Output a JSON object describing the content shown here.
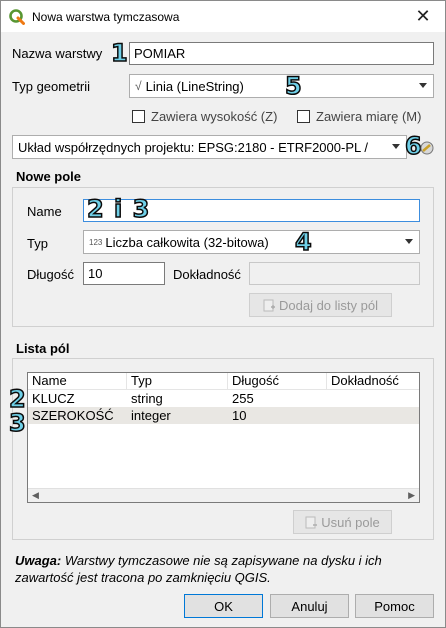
{
  "window": {
    "title": "Nowa warstwa tymczasowa",
    "close_glyph": "✕"
  },
  "layer_name": {
    "label": "Nazwa warstwy",
    "value": "POMIAR",
    "callout": "1"
  },
  "geometry": {
    "label": "Typ geometrii",
    "value": "Linia (LineString)",
    "icon_glyph": "√",
    "callout": "5"
  },
  "checks": {
    "has_z": "Zawiera wysokość (Z)",
    "has_m": "Zawiera miarę (M)"
  },
  "crs": {
    "value": "Układ współrzędnych projektu: EPSG:2180 - ETRF2000-PL /",
    "callout": "6"
  },
  "new_field": {
    "title": "Nowe pole",
    "name_label": "Name",
    "name_value": "",
    "name_callout": "2 i 3",
    "type_label": "Typ",
    "type_value": "Liczba całkowita (32-bitowa)",
    "type_icon": "123",
    "type_callout": "4",
    "length_label": "Długość",
    "length_value": "10",
    "precision_label": "Dokładność",
    "precision_value": "",
    "add_button": "Dodaj do listy pól"
  },
  "field_list": {
    "title": "Lista pól",
    "columns": [
      "Name",
      "Typ",
      "Długość",
      "Dokładność"
    ],
    "rows": [
      {
        "name": "KLUCZ",
        "type": "string",
        "length": "255",
        "precision": "",
        "callout": "2"
      },
      {
        "name": "SZEROKOŚĆ",
        "type": "integer",
        "length": "10",
        "precision": "",
        "callout": "3"
      }
    ],
    "scroll_left": "◀",
    "scroll_right": "▶",
    "remove_button": "Usuń pole"
  },
  "note": {
    "bold": "Uwaga:",
    "text": " Warstwy tymczasowe nie są zapisywane na dysku i ich zawartość jest tracona po zamknięciu QGIS."
  },
  "buttons": {
    "ok": "OK",
    "cancel": "Anuluj",
    "help": "Pomoc"
  },
  "colors": {
    "focus": "#3c8dde",
    "callout_fill": "#6fd0e8",
    "qgis_green": "#589632",
    "qgis_yellow": "#ee7913"
  }
}
